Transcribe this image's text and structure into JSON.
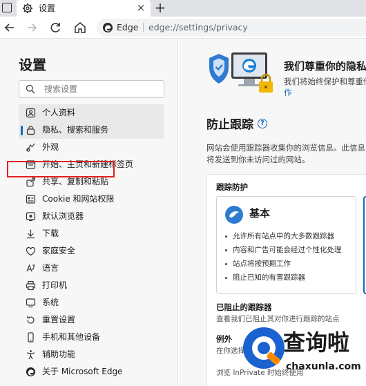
{
  "tab": {
    "title": "设置",
    "close": "×",
    "new_tab": "+"
  },
  "omnibox": {
    "brand": "Edge",
    "url": "edge://settings/privacy"
  },
  "sidebar": {
    "title": "设置",
    "search_placeholder": "搜索设置",
    "items": [
      {
        "label": "个人资料",
        "icon": "profile-icon"
      },
      {
        "label": "隐私、搜索和服务",
        "icon": "lock-icon"
      },
      {
        "label": "外观",
        "icon": "appearance-icon"
      },
      {
        "label": "开始、主页和新建标签页",
        "icon": "home-icon"
      },
      {
        "label": "共享、复制和粘贴",
        "icon": "share-icon"
      },
      {
        "label": "Cookie 和网站权限",
        "icon": "cookie-icon"
      },
      {
        "label": "默认浏览器",
        "icon": "browser-icon"
      },
      {
        "label": "下载",
        "icon": "download-icon"
      },
      {
        "label": "家庭安全",
        "icon": "family-icon"
      },
      {
        "label": "语言",
        "icon": "language-icon"
      },
      {
        "label": "打印机",
        "icon": "printer-icon"
      },
      {
        "label": "系统",
        "icon": "system-icon"
      },
      {
        "label": "重置设置",
        "icon": "reset-icon"
      },
      {
        "label": "手机和其他设备",
        "icon": "phone-icon"
      },
      {
        "label": "辅助功能",
        "icon": "accessibility-icon"
      },
      {
        "label": "关于 Microsoft Edge",
        "icon": "edge-icon"
      }
    ]
  },
  "main": {
    "hero_title": "我们尊重你的隐私",
    "hero_desc": "我们将始终保护和尊重你",
    "hero_link": "作",
    "section_title": "防止跟踪",
    "help": "?",
    "section_desc": "网站会使用跟踪器收集你的浏览信息。此信息将发送到你未访问过的网站。",
    "tracking_title": "跟踪防护",
    "option_title": "基本",
    "option_bullets": [
      "允许所有站点中的大多数跟踪器",
      "内容和广告可能会经过个性化处理",
      "站点将按预期工作",
      "阻止已知的有害跟踪器"
    ],
    "blocked_title": "已阻止的跟踪器",
    "blocked_desc": "查看我们已阻止其对你进行跟踪的站点",
    "exceptions_title": "例外",
    "exceptions_desc": "在你选择",
    "footer_text": "浏览 InPrivate 时始终使用"
  },
  "watermark": {
    "text": "查询啦",
    "domain": "chaxunla.com"
  }
}
